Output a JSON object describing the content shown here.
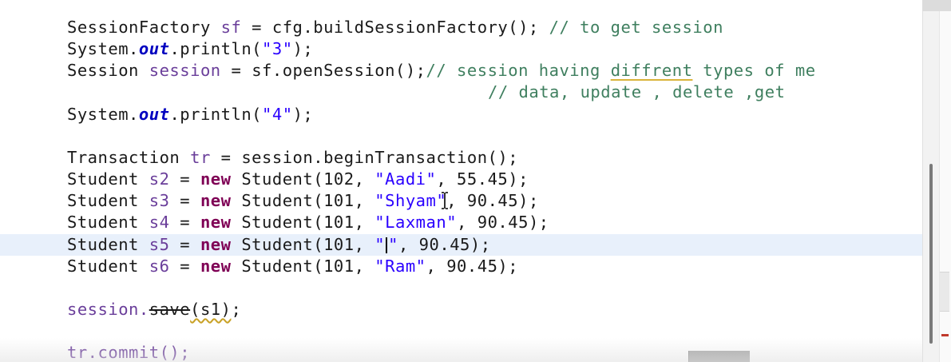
{
  "code": {
    "line1": {
      "type": "SessionFactory",
      "var": "sf",
      "eq": "=",
      "expr": "cfg.buildSessionFactory();",
      "comment": "// to get session"
    },
    "line2": {
      "prefix": "System.",
      "field": "out",
      "rest": ".println(",
      "arg": "\"3\"",
      "end": ");"
    },
    "line3": {
      "type": "Session",
      "var": "session",
      "eq": "=",
      "expr": "sf.openSession();",
      "comment_a": "// session having ",
      "comment_typo": "diffrent",
      "comment_b": " types of me"
    },
    "line4": {
      "comment_a": "// data, update , delete ,get"
    },
    "line5": {
      "prefix": "System.",
      "field": "out",
      "rest": ".println(",
      "arg": "\"4\"",
      "end": ");"
    },
    "line6": {
      "type": "Transaction",
      "var": "tr",
      "eq": "=",
      "expr": "session.beginTransaction();"
    },
    "students": [
      {
        "type": "Student",
        "var": "s2",
        "kw": "new",
        "ctor": "Student(102, ",
        "name": "\"Aadi\"",
        "tail": ", 55.45);"
      },
      {
        "type": "Student",
        "var": "s3",
        "kw": "new",
        "ctor": "Student(101, ",
        "name": "\"Shyam\"",
        "tail": ", 90.45);"
      },
      {
        "type": "Student",
        "var": "s4",
        "kw": "new",
        "ctor": "Student(101, ",
        "name": "\"Laxman\"",
        "tail": ", 90.45);"
      },
      {
        "type": "Student",
        "var": "s5",
        "kw": "new",
        "ctor": "Student(101, ",
        "name_open": "\"",
        "name_close": "\"",
        "tail": ", 90.45);"
      },
      {
        "type": "Student",
        "var": "s6",
        "kw": "new",
        "ctor": "Student(101, ",
        "name": "\"Ram\"",
        "tail": ", 90.45);"
      }
    ],
    "save_line": {
      "obj": "session.",
      "method": "save",
      "args": "(s1)",
      "end": ";"
    },
    "commit_line": {
      "text": "tr.commit();"
    }
  },
  "colors": {
    "keyword": "#7f0055",
    "string": "#2a00ff",
    "comment": "#3f7f5f",
    "static_field": "#0000c0",
    "current_line_highlight": "#e8f0fb",
    "spelling_underline": "#d9b43a",
    "error_marker": "#c0392b"
  }
}
